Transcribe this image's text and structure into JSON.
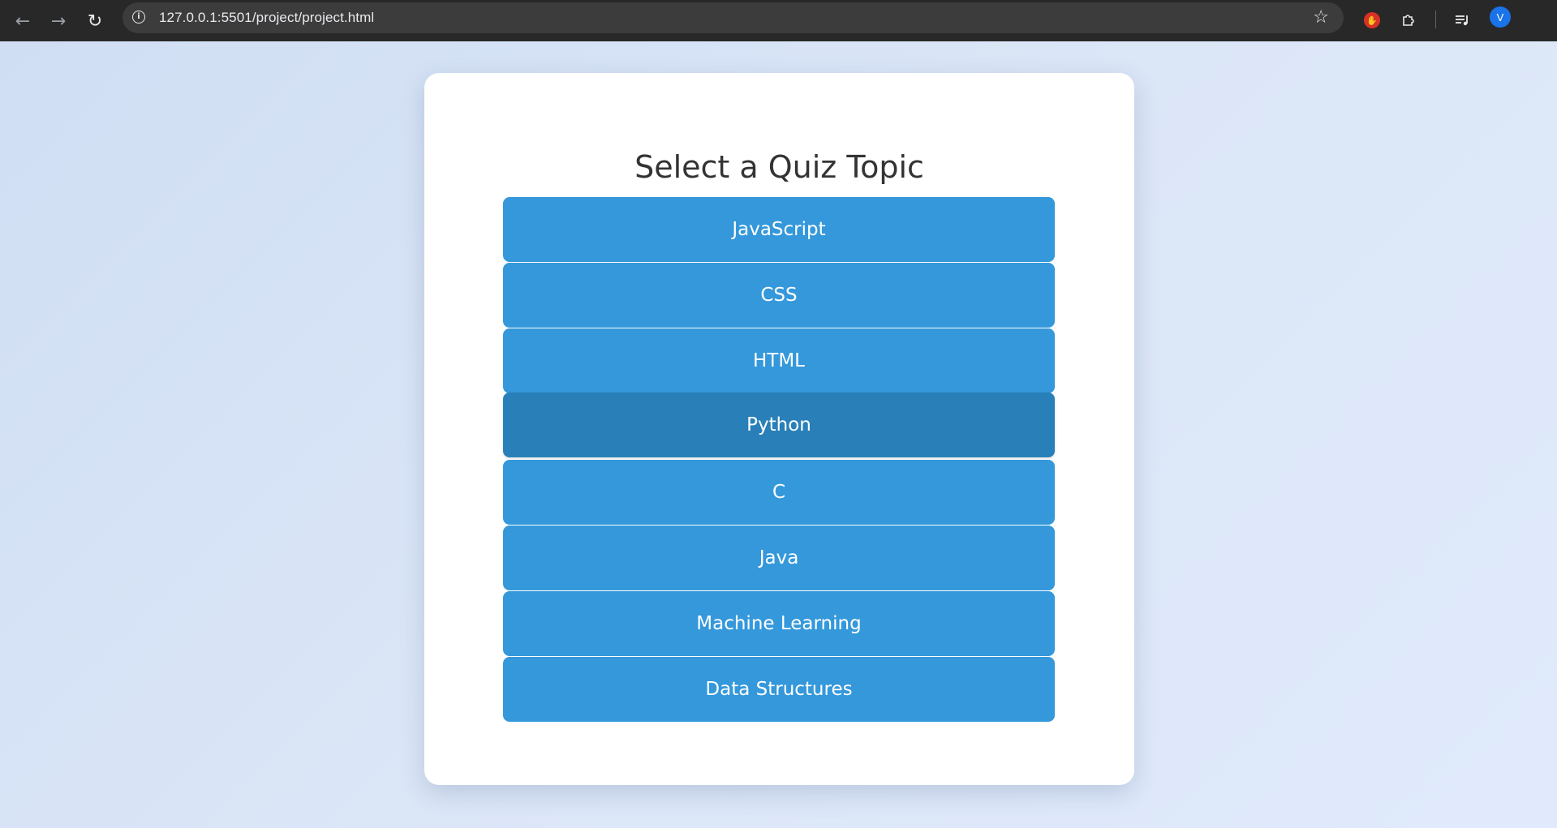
{
  "browser": {
    "url": "127.0.0.1:5501/project/project.html",
    "icons": {
      "back": "back-arrow-icon",
      "forward": "forward-arrow-icon",
      "reload": "reload-icon",
      "info": "info-icon",
      "bookmark": "star-icon",
      "adblock": "adblock-icon",
      "extensions": "puzzle-icon",
      "media": "media-queue-icon"
    },
    "profile_initial": "V"
  },
  "quiz": {
    "title": "Select a Quiz Topic",
    "topics": [
      {
        "label": "JavaScript"
      },
      {
        "label": "CSS"
      },
      {
        "label": "HTML"
      },
      {
        "label": "Python",
        "state": "hover"
      },
      {
        "label": "C"
      },
      {
        "label": "Java"
      },
      {
        "label": "Machine Learning"
      },
      {
        "label": "Data Structures"
      }
    ]
  },
  "colors": {
    "button": "#3498db",
    "button_hover": "#2980b9",
    "title_text": "#333333",
    "card": "#ffffff",
    "chrome_bar": "#282828"
  }
}
